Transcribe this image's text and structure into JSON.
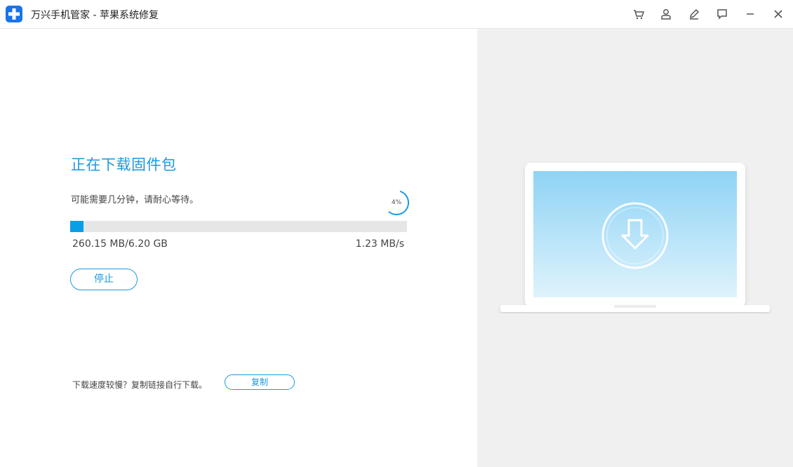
{
  "app": {
    "title": "万兴手机管家 - 苹果系统修复"
  },
  "titlebar_icons": [
    "cart-icon",
    "user-icon",
    "edit-icon",
    "feedback-icon",
    "minimize-icon",
    "close-icon"
  ],
  "download": {
    "heading": "正在下载固件包",
    "subtext": "可能需要几分钟，请耐心等待。",
    "percent_label": "4%",
    "progress_fraction": 0.04,
    "size_text": "260.15 MB/6.20 GB",
    "speed_text": "1.23 MB/s",
    "stop_label": "停止"
  },
  "footer": {
    "slow_text": "下载速度较慢？复制链接自行下载。",
    "copy_label": "复制"
  },
  "colors": {
    "accent": "#1a9ae0",
    "progress": "#0a9ee6",
    "right_bg": "#f0f0f0"
  }
}
